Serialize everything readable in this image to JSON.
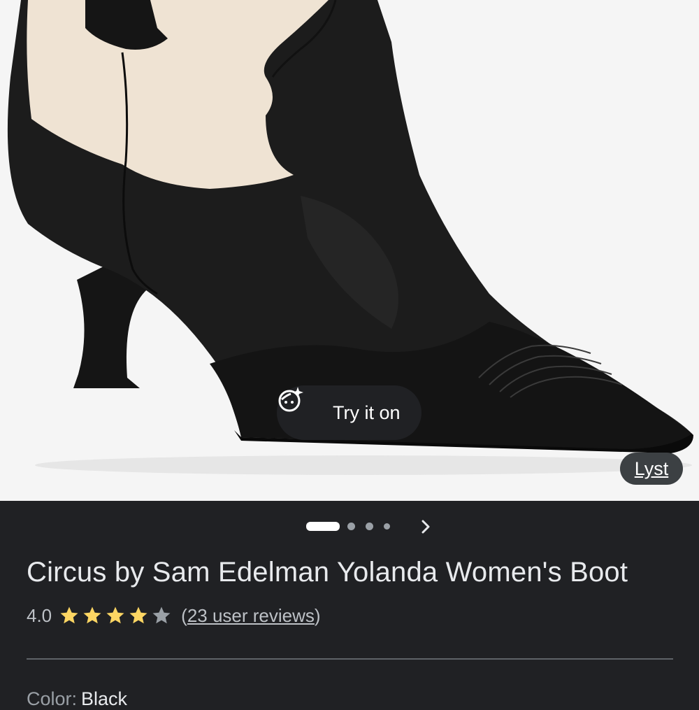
{
  "product": {
    "title": "Circus by Sam Edelman Yolanda Women's Boot",
    "image_alt": "Black and cream western-style kitten heel ankle boot",
    "try_on_label": "Try it on",
    "source_label": "Lyst"
  },
  "carousel": {
    "pages": 4,
    "active_page": 1
  },
  "rating": {
    "value": "4.0",
    "stars": 4,
    "max_stars": 5,
    "reviews_label": "23 user reviews",
    "open_paren": "(",
    "close_paren": ")"
  },
  "color": {
    "label": "Color:",
    "value": "Black"
  },
  "colors": {
    "background": "#202124",
    "star_filled": "#fdd663",
    "star_empty": "#9aa0a6",
    "text_primary": "#e8eaed",
    "text_secondary": "#bdc1c6"
  },
  "icons": {
    "try_on": "face-sparkle-icon",
    "next": "chevron-right-icon",
    "star": "star-icon"
  }
}
